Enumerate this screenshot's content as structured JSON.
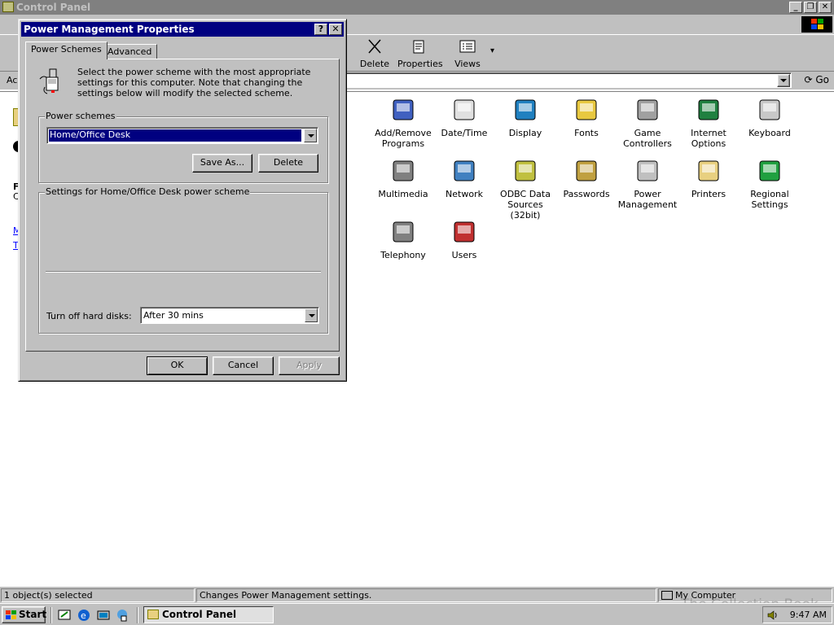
{
  "window": {
    "title": "Control Panel",
    "min_glyph": "_",
    "max_glyph": "❐",
    "close_glyph": "✕"
  },
  "toolbar": {
    "delete_label": "Delete",
    "properties_label": "Properties",
    "views_label": "Views",
    "views_glyph": "▾"
  },
  "address": {
    "label": "Ac",
    "go_label": "Go",
    "go_glyph": "⟳"
  },
  "left_pane_fragments": [
    "F",
    "C",
    "M",
    "T"
  ],
  "icons": [
    {
      "label": "New\nware",
      "name": "add-new-hardware-icon"
    },
    {
      "label": "Add/Remove\nPrograms",
      "name": "add-remove-programs-icon"
    },
    {
      "label": "Date/Time",
      "name": "date-time-icon"
    },
    {
      "label": "Display",
      "name": "display-icon"
    },
    {
      "label": "Fonts",
      "name": "fonts-icon"
    },
    {
      "label": "Game\nControllers",
      "name": "game-controllers-icon"
    },
    {
      "label": "Internet\nOptions",
      "name": "internet-options-icon"
    },
    {
      "label": "Keyboard",
      "name": "keyboard-icon"
    },
    {
      "label": "se",
      "name": "mouse-icon"
    },
    {
      "label": "Multimedia",
      "name": "multimedia-icon"
    },
    {
      "label": "Network",
      "name": "network-icon"
    },
    {
      "label": "ODBC Data\nSources (32bit)",
      "name": "odbc-icon"
    },
    {
      "label": "Passwords",
      "name": "passwords-icon"
    },
    {
      "label": "Power\nManagement",
      "name": "power-management-icon"
    },
    {
      "label": "Printers",
      "name": "printers-icon"
    },
    {
      "label": "Regional\nSettings",
      "name": "regional-settings-icon"
    },
    {
      "label": "em",
      "name": "system-icon"
    },
    {
      "label": "Telephony",
      "name": "telephony-icon"
    },
    {
      "label": "Users",
      "name": "users-icon"
    }
  ],
  "status": {
    "selected": "1 object(s) selected",
    "description": "Changes Power Management settings.",
    "location": "My Computer"
  },
  "watermark": "The Collection Book",
  "taskbar": {
    "start_label": "Start",
    "task_label": "Control Panel",
    "clock": "9:47 AM"
  },
  "dialog": {
    "title": "Power Management Properties",
    "help_glyph": "?",
    "close_glyph": "✕",
    "tabs": [
      "Power Schemes",
      "Advanced"
    ],
    "intro": "Select the power scheme with the most appropriate settings for this computer. Note that changing the settings below will modify the selected scheme.",
    "schemes_label": "Power schemes",
    "scheme_value": "Home/Office Desk",
    "save_as_label": "Save As...",
    "delete_label": "Delete",
    "settings_label": "Settings for Home/Office Desk power scheme",
    "hdd_label": "Turn off hard disks:",
    "hdd_value": "After 30 mins",
    "ok_label": "OK",
    "cancel_label": "Cancel",
    "apply_label": "Apply"
  },
  "colors": {
    "active_title": "#000080",
    "inactive_title": "#808080",
    "face": "#c0c0c0"
  }
}
